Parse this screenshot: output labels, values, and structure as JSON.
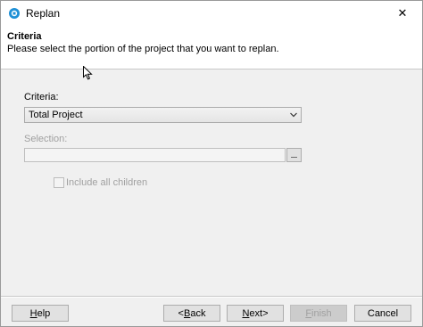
{
  "window": {
    "title": "Replan",
    "close_glyph": "✕",
    "icon": "replan-app-icon"
  },
  "header": {
    "title": "Criteria",
    "subtitle": "Please select the portion of the project that you want to replan."
  },
  "form": {
    "criteria_label": "Criteria:",
    "criteria_value": "Total Project",
    "selection_label": "Selection:",
    "selection_value": "",
    "selection_button_icon": "ellipsis-icon",
    "include_children_label": "Include all children",
    "include_children_checked": false
  },
  "buttons": {
    "help": {
      "accel": "H",
      "rest": "elp"
    },
    "back": {
      "prefix": "<",
      "accel": "B",
      "rest": "ack"
    },
    "next": {
      "prefix": "",
      "accel": "N",
      "rest": "ext>"
    },
    "finish": {
      "accel": "F",
      "rest": "inish"
    },
    "cancel": "Cancel"
  },
  "colors": {
    "accent": "#1e90d6",
    "window_bg": "#f0f0f0",
    "disabled_text": "#a0a0a0"
  }
}
